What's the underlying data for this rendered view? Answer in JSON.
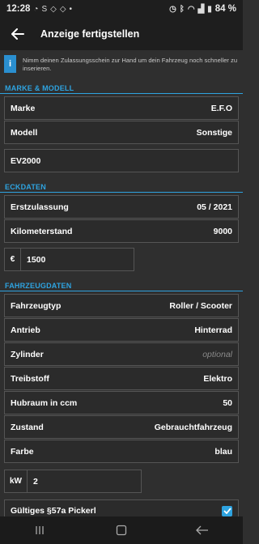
{
  "status_bar": {
    "time": "12:28",
    "battery": "84 %"
  },
  "app_bar": {
    "title": "Anzeige fertigstellen"
  },
  "info": {
    "icon_letter": "i",
    "text": "Nimm deinen Zulassungsschein zur Hand um dein Fahrzeug noch schneller zu inserieren."
  },
  "sections": {
    "marke_modell": "MARKE & MODELL",
    "eckdaten": "ECKDATEN",
    "fahrzeugdaten": "FAHRZEUGDATEN"
  },
  "marke": {
    "label": "Marke",
    "value": "E.F.O"
  },
  "modell": {
    "label": "Modell",
    "value": "Sonstige"
  },
  "modell_text": {
    "value": "EV2000"
  },
  "erstzulassung": {
    "label": "Erstzulassung",
    "value": "05 / 2021"
  },
  "kilometerstand": {
    "label": "Kilometerstand",
    "value": "9000"
  },
  "preis": {
    "unit": "€",
    "value": "1500"
  },
  "fahrzeugtyp": {
    "label": "Fahrzeugtyp",
    "value": "Roller / Scooter"
  },
  "antrieb": {
    "label": "Antrieb",
    "value": "Hinterrad"
  },
  "zylinder": {
    "label": "Zylinder",
    "placeholder": "optional"
  },
  "treibstoff": {
    "label": "Treibstoff",
    "value": "Elektro"
  },
  "hubraum": {
    "label": "Hubraum in ccm",
    "value": "50"
  },
  "zustand": {
    "label": "Zustand",
    "value": "Gebrauchtfahrzeug"
  },
  "farbe": {
    "label": "Farbe",
    "value": "blau"
  },
  "leistung": {
    "unit": "kW",
    "value": "2"
  },
  "pickerl": {
    "label": "Gültiges §57a Pickerl",
    "checked": true
  },
  "colors": {
    "accent": "#2ea3e0",
    "background": "#2f2f2f",
    "row_border": "#555555"
  }
}
